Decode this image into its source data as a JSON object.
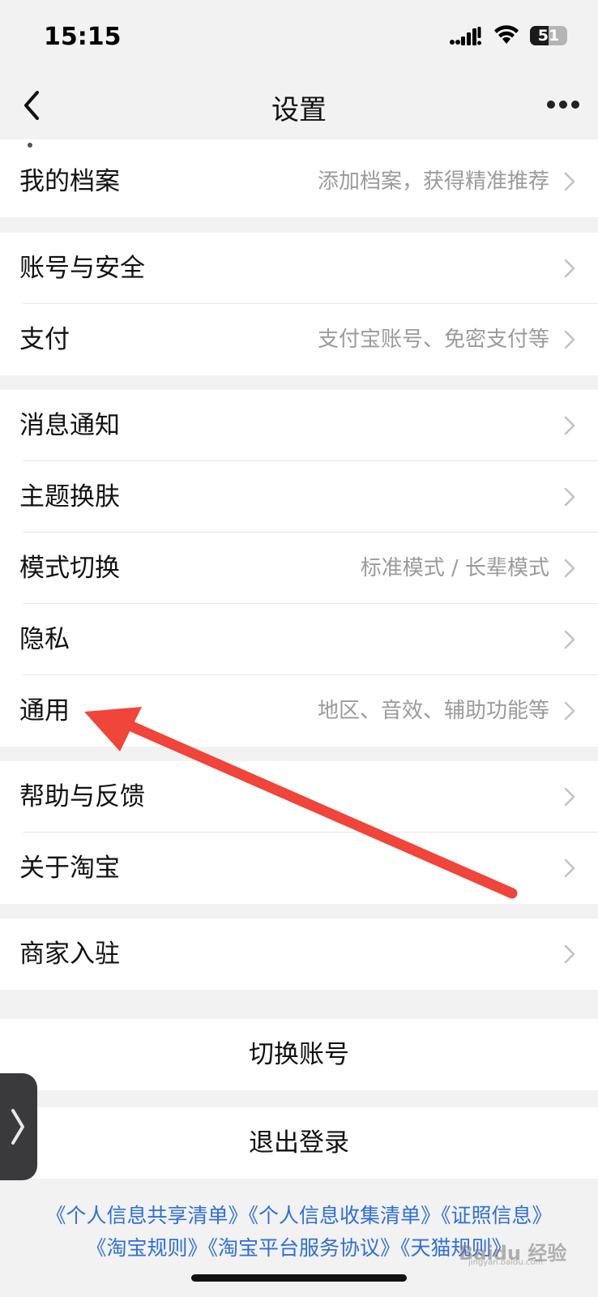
{
  "status_bar": {
    "time": "15:15",
    "battery": "51",
    "battery_level": 0.51,
    "icons": [
      "signal-icon",
      "wifi-icon",
      "battery-icon"
    ]
  },
  "nav": {
    "title": "设置",
    "back_icon": "chevron-left-icon",
    "more_icon": "more-horizontal-icon"
  },
  "sections": [
    {
      "items": [
        {
          "label": "我的档案",
          "detail": "添加档案，获得精准推荐"
        }
      ]
    },
    {
      "items": [
        {
          "label": "账号与安全",
          "detail": ""
        },
        {
          "label": "支付",
          "detail": "支付宝账号、免密支付等"
        }
      ]
    },
    {
      "items": [
        {
          "label": "消息通知",
          "detail": ""
        },
        {
          "label": "主题换肤",
          "detail": ""
        },
        {
          "label": "模式切换",
          "detail": "标准模式 / 长辈模式"
        },
        {
          "label": "隐私",
          "detail": ""
        },
        {
          "label": "通用",
          "detail": "地区、音效、辅助功能等"
        }
      ]
    },
    {
      "items": [
        {
          "label": "帮助与反馈",
          "detail": ""
        },
        {
          "label": "关于淘宝",
          "detail": ""
        }
      ]
    },
    {
      "items": [
        {
          "label": "商家入驻",
          "detail": ""
        }
      ]
    }
  ],
  "actions": {
    "switch_account": "切换账号",
    "logout": "退出登录"
  },
  "footer": {
    "line1": "《个人信息共享清单》《个人信息收集清单》《证照信息》",
    "line2": "《淘宝规则》《淘宝平台服务协议》《天猫规则》"
  },
  "watermark": {
    "text": "Baidu 经验",
    "sub": "jingyan.baidu.com"
  },
  "colors": {
    "background": "#f2f2f2",
    "link": "#2f6fd6",
    "annotation_arrow": "#f0453a",
    "detail_text": "#9b9b9b"
  }
}
